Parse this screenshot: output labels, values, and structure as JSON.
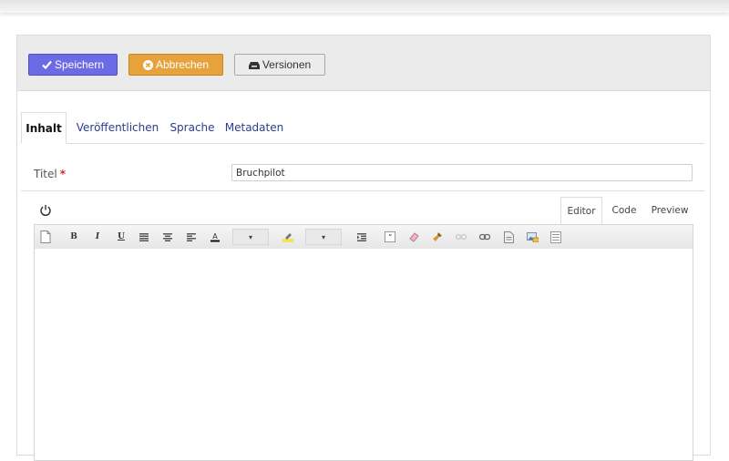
{
  "actions": {
    "save_label": "Speichern",
    "cancel_label": "Abbrechen",
    "versions_label": "Versionen"
  },
  "tabs": [
    {
      "label": "Inhalt",
      "active": true
    },
    {
      "label": "Veröffentlichen",
      "active": false
    },
    {
      "label": "Sprache",
      "active": false
    },
    {
      "label": "Metadaten",
      "active": false
    }
  ],
  "form": {
    "title_label": "Titel",
    "required_marker": "*",
    "title_value": "Bruchpilot"
  },
  "editor": {
    "view_tabs": [
      {
        "label": "Editor",
        "active": true
      },
      {
        "label": "Code",
        "active": false
      },
      {
        "label": "Preview",
        "active": false
      }
    ],
    "dropdown_arrow": "▾"
  },
  "icons": {
    "save": "check-icon",
    "cancel": "x-circle-icon",
    "versions": "archive-icon",
    "power": "power-icon"
  },
  "colors": {
    "save": "#6b6be6",
    "cancel": "#e6a33c",
    "tab_link": "#2b3e8c",
    "required": "#c0392b"
  }
}
